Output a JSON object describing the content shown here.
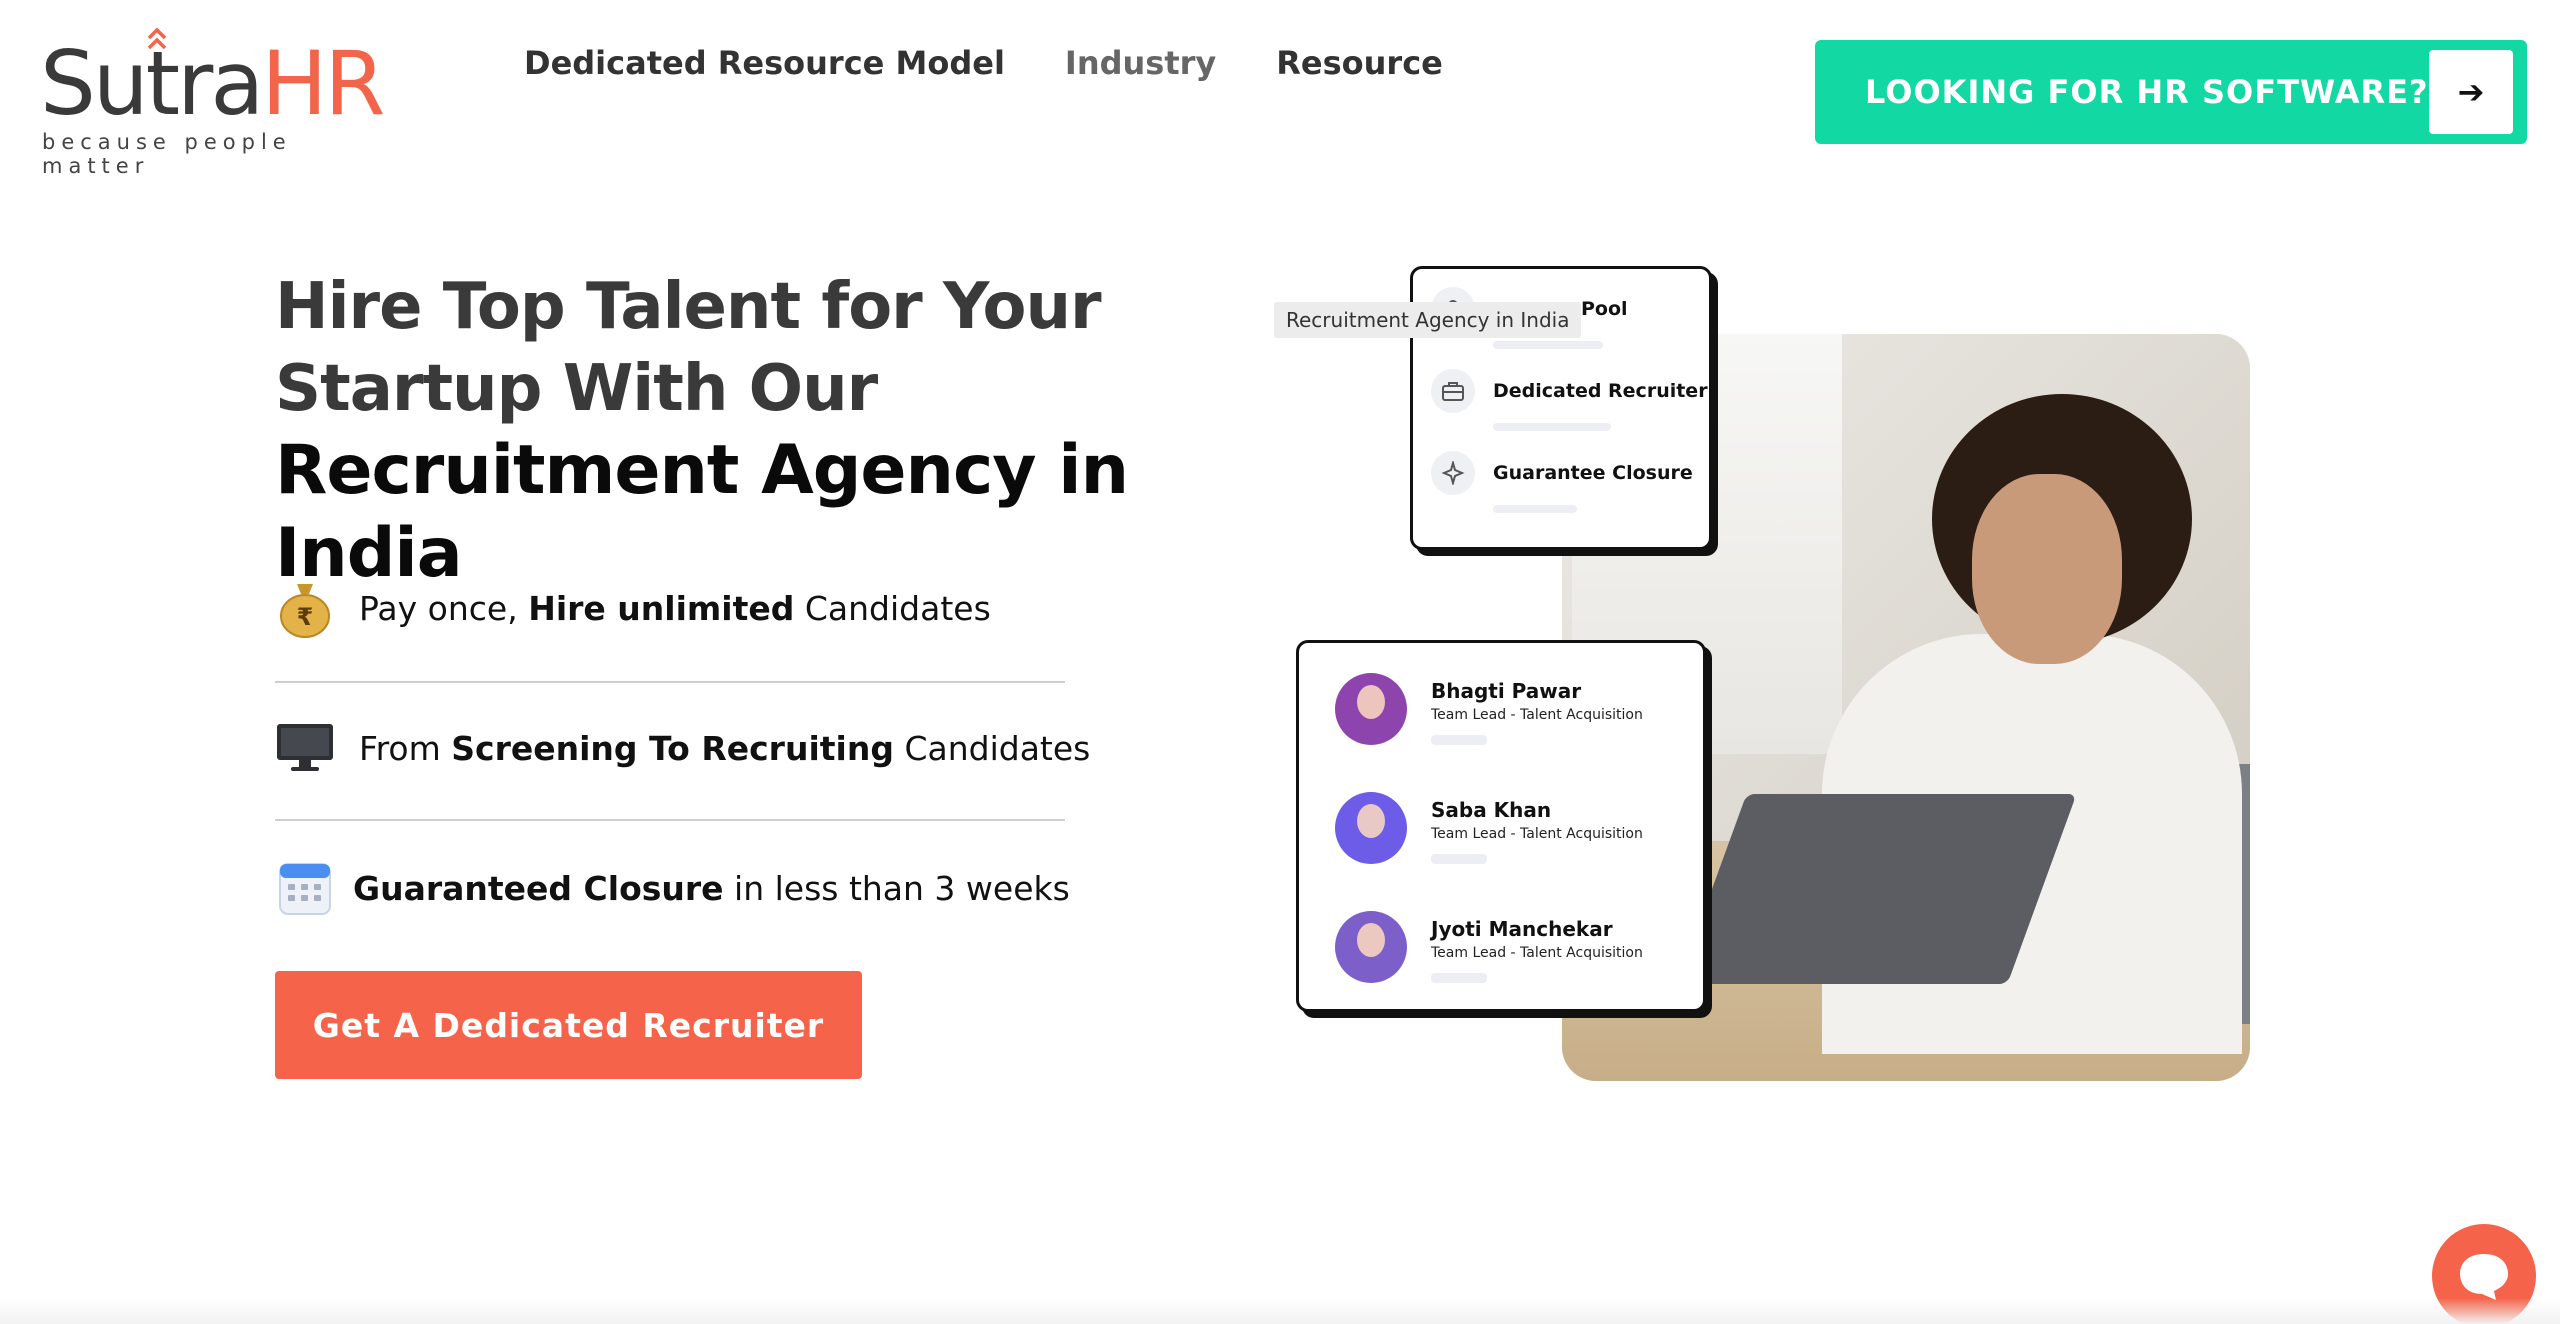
{
  "header": {
    "logo": {
      "brand_part1": "Sutra",
      "brand_part2": "HR",
      "tagline": "because people matter"
    },
    "nav": [
      {
        "label": "Dedicated Resource Model"
      },
      {
        "label": "Industry"
      },
      {
        "label": "Resource"
      }
    ],
    "cta": {
      "label": "LOOKING FOR HR SOFTWARE?",
      "arrow": "➔"
    }
  },
  "hero": {
    "title_line1": "Hire Top Talent for Your",
    "title_line2": "Startup With Our",
    "title_line3": "Recruitment Agency in India",
    "features": [
      {
        "icon": "money-bag-icon",
        "pre": "Pay once, ",
        "bold": "Hire unlimited",
        "post": " Candidates"
      },
      {
        "icon": "monitor-icon",
        "pre": "From ",
        "bold": "Screening To Recruiting",
        "post": " Candidates"
      },
      {
        "icon": "calendar-icon",
        "pre": "",
        "bold": "Guaranteed Closure",
        "post": " in less than 3 weeks"
      }
    ],
    "cta_label": "Get A Dedicated Recruiter"
  },
  "visual": {
    "tooltip": "Recruitment Agency in India",
    "services_card": {
      "items": [
        {
          "label": "Pool",
          "icon": "people-icon"
        },
        {
          "label": "Dedicated Recruiter",
          "icon": "briefcase-icon"
        },
        {
          "label": "Guarantee Closure",
          "icon": "sparkle-icon"
        }
      ]
    },
    "people_card": {
      "people": [
        {
          "name": "Bhagti Pawar",
          "role": "Team Lead - Talent Acquisition",
          "avatar_color": "#8e44ad"
        },
        {
          "name": "Saba Khan",
          "role": "Team Lead - Talent Acquisition",
          "avatar_color": "#6c5ce7"
        },
        {
          "name": "Jyoti Manchekar",
          "role": "Team Lead - Talent Acquisition",
          "avatar_color": "#7d5fc9"
        }
      ]
    }
  },
  "colors": {
    "accent_orange": "#f5644a",
    "accent_green": "#12d8a4",
    "text_dark": "#333333"
  }
}
